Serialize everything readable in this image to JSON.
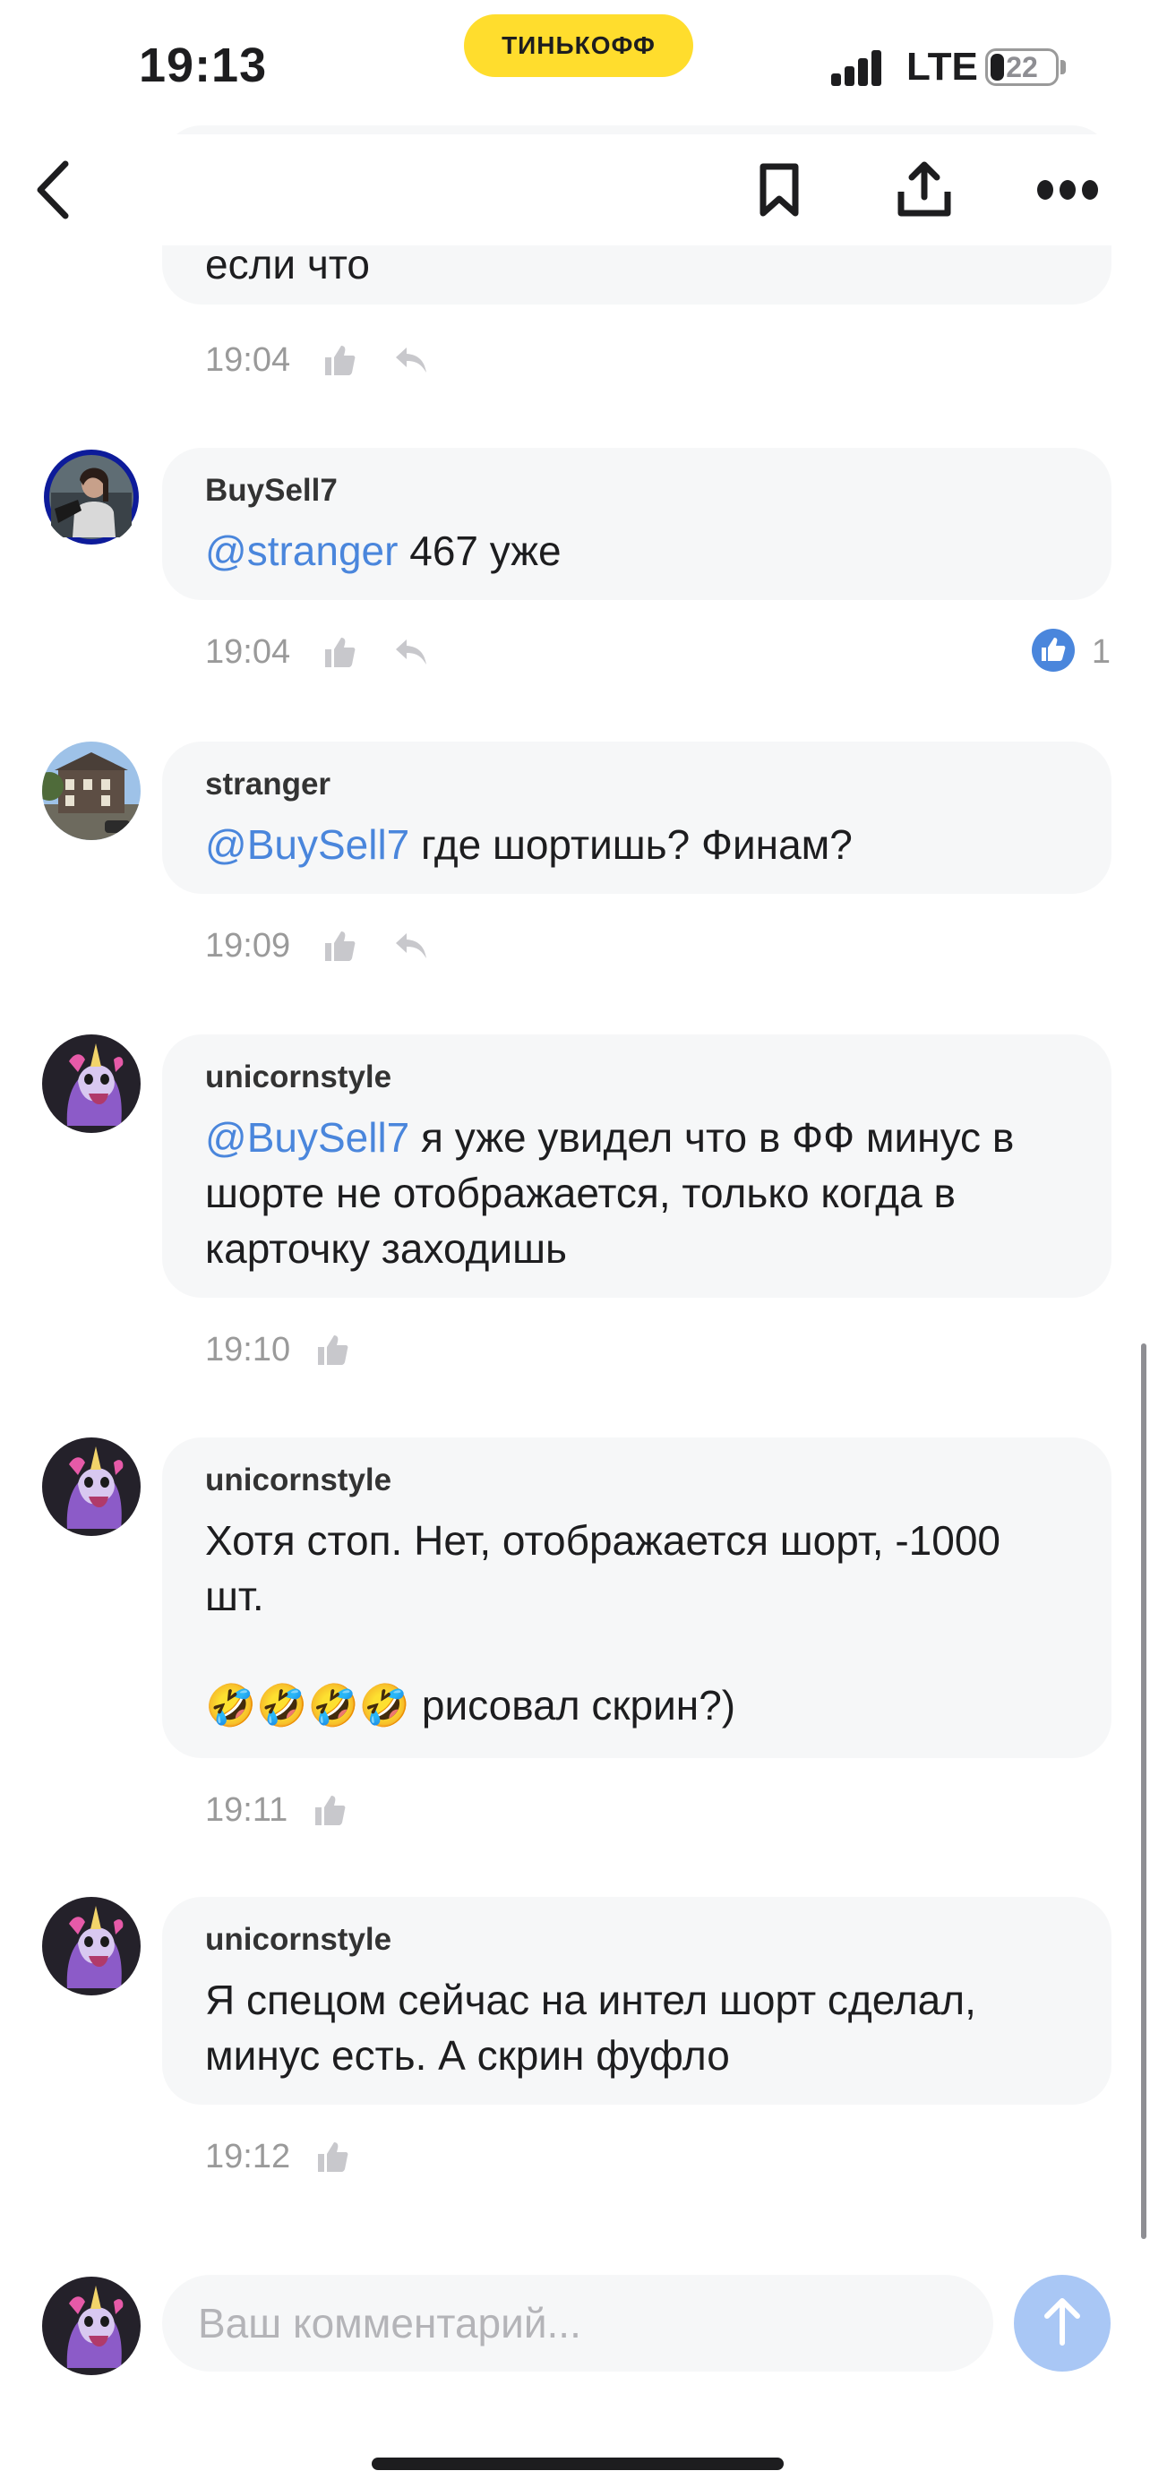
{
  "status_bar": {
    "time": "19:13",
    "brand": "ТИНЬКОФФ",
    "network": "LTE",
    "battery": "22",
    "battery_level": 0.22
  },
  "nav": {
    "back_icon": "chevron-left-icon",
    "bookmark_icon": "bookmark-icon",
    "share_icon": "share-icon",
    "more_icon": "more-icon"
  },
  "comments": [
    {
      "author": "",
      "text_parts": [
        "если что"
      ],
      "time": "19:04",
      "avatar": "none",
      "reactions": null
    },
    {
      "author": "BuySell7",
      "mention": "@stranger",
      "text": " 467 уже",
      "time": "19:04",
      "avatar": "driver-photo",
      "reactions": {
        "icon": "like-badge-icon",
        "count": "1"
      }
    },
    {
      "author": "stranger",
      "mention": "@BuySell7",
      "text": " где шортишь? Финам?",
      "time": "19:09",
      "avatar": "building-photo",
      "reactions": null
    },
    {
      "author": "unicornstyle",
      "mention": "@BuySell7",
      "text": " я уже увидел что в ФФ минус в шорте не отображается, только когда в карточку заходишь",
      "time": "19:10",
      "avatar": "unicorn",
      "reactions": null
    },
    {
      "author": "unicornstyle",
      "text_line1": "Хотя стоп. Нет, отображается шорт, -1000 шт.",
      "text_line2": "🤣🤣🤣🤣 рисовал скрин?)",
      "time": "19:11",
      "avatar": "unicorn",
      "reactions": null
    },
    {
      "author": "unicornstyle",
      "text": "Я спецом сейчас на интел шорт сделал, минус есть. А скрин фуфло",
      "time": "19:12",
      "avatar": "unicorn",
      "reactions": null
    }
  ],
  "composer": {
    "placeholder": "Ваш комментарий...",
    "send_icon": "arrow-up-icon"
  },
  "colors": {
    "accent": "#ffdd2d",
    "mention": "#4a86dc",
    "like": "#4a86dc",
    "bubble": "#f6f7f8",
    "send": "#a9c7f5"
  }
}
